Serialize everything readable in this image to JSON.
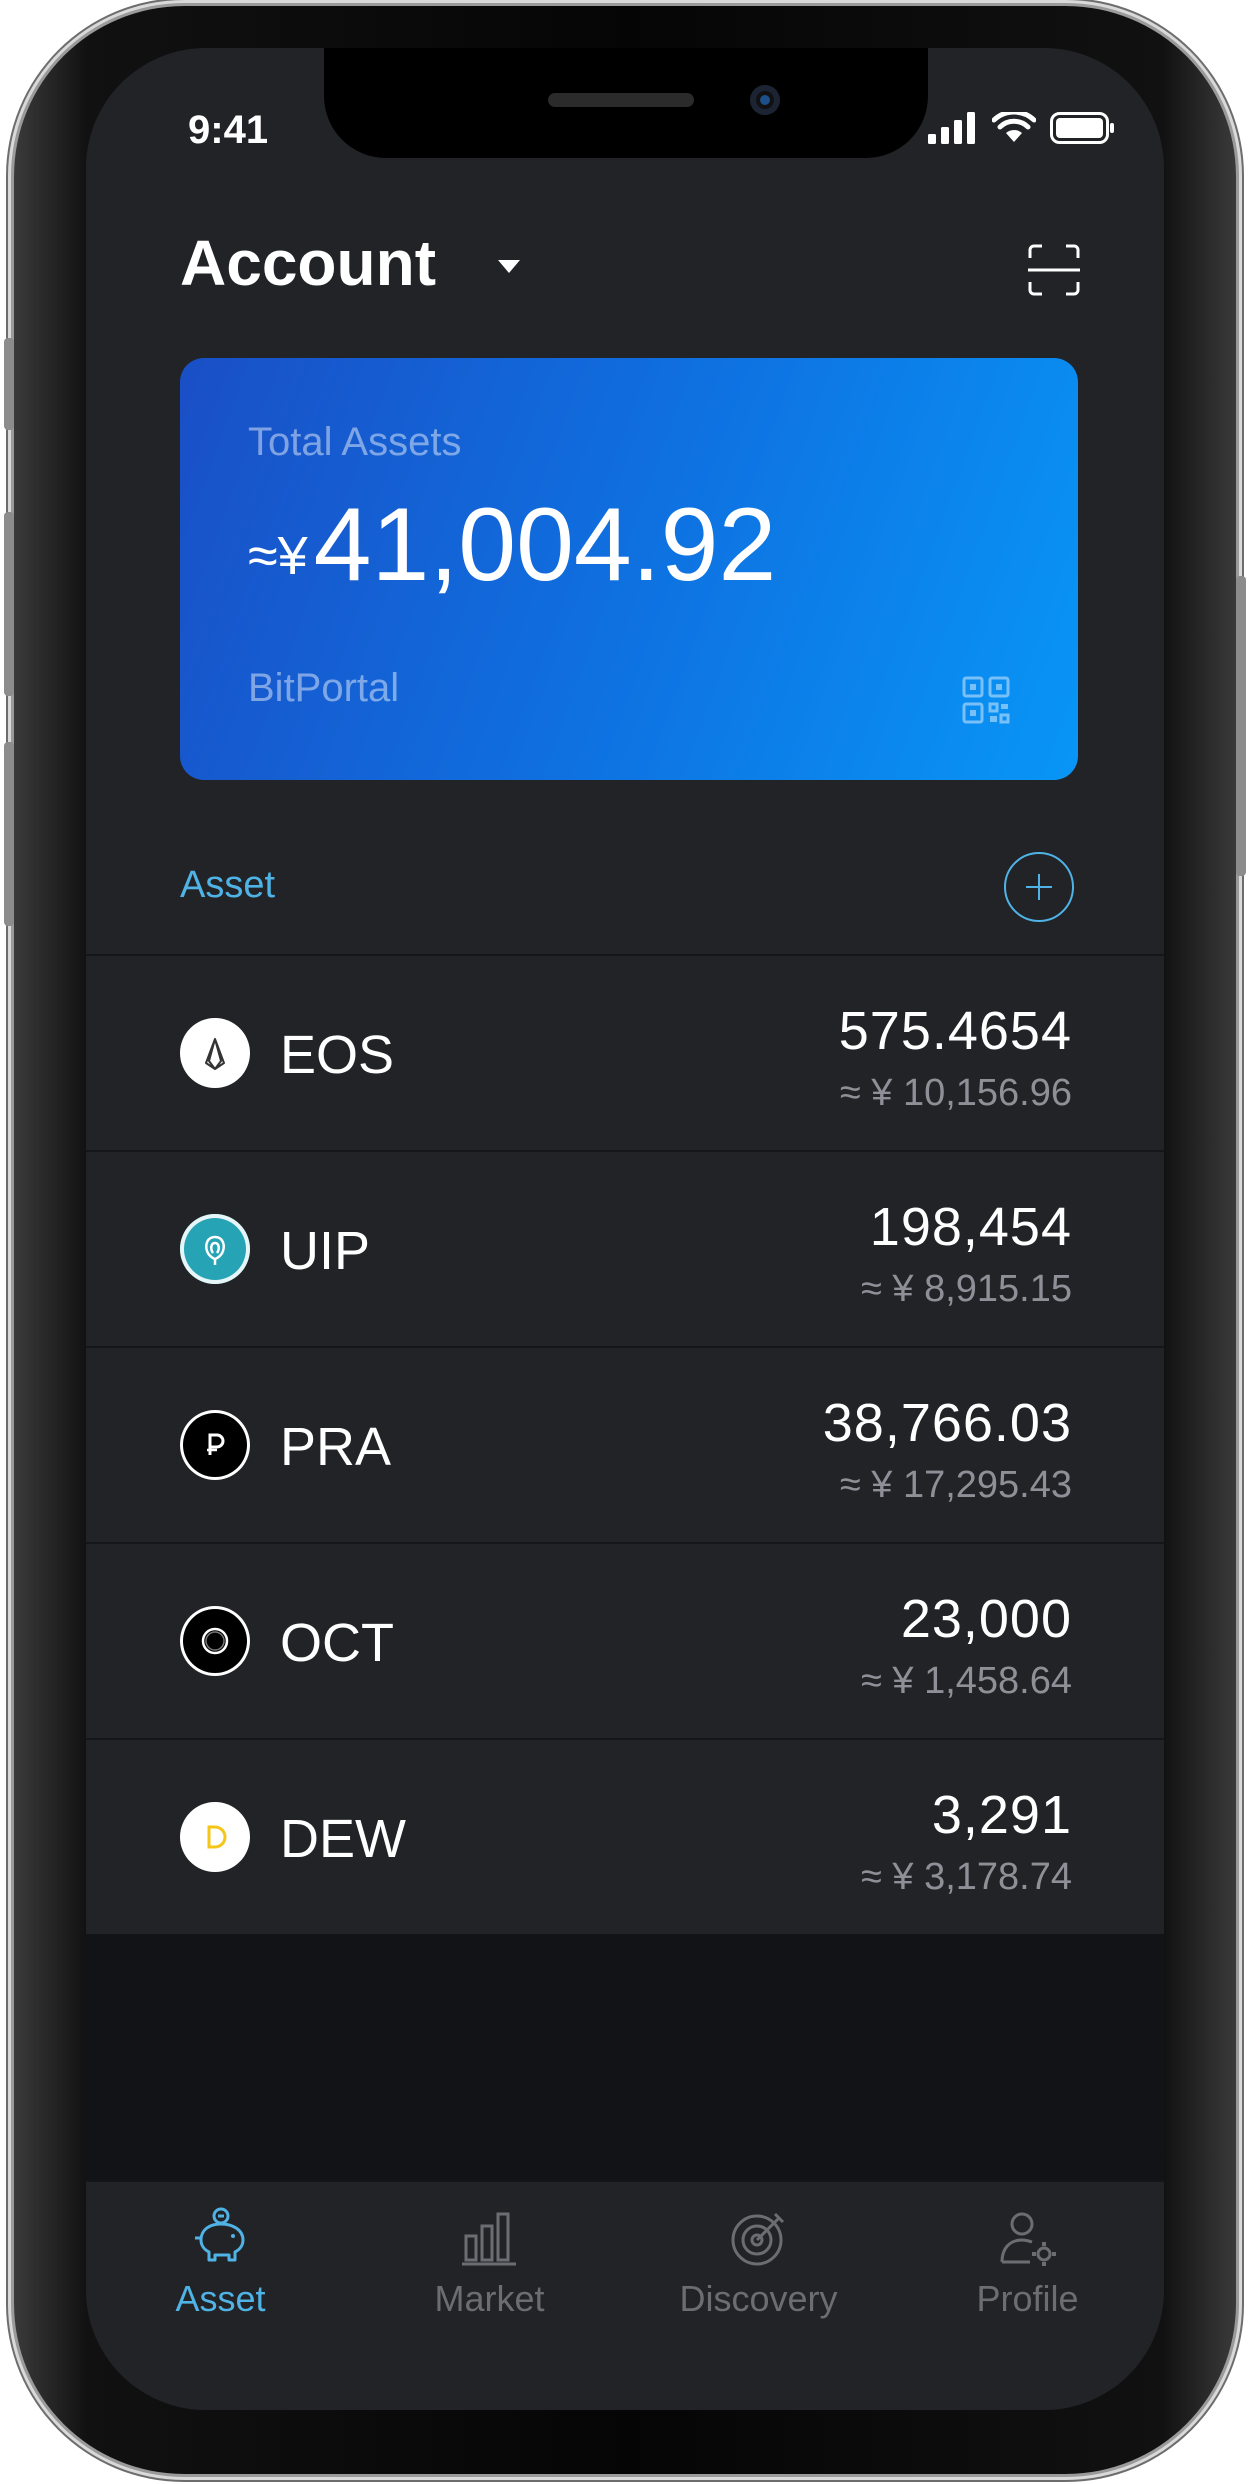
{
  "status_bar": {
    "time": "9:41"
  },
  "header": {
    "title": "Account"
  },
  "total_card": {
    "label": "Total Assets",
    "prefix": "≈¥",
    "value": "41,004.92",
    "brand": "BitPortal"
  },
  "assets_section": {
    "title": "Asset"
  },
  "assets": [
    {
      "symbol": "EOS",
      "amount": "575.4654",
      "value": "≈ ¥ 10,156.96",
      "icon": "eos-icon"
    },
    {
      "symbol": "UIP",
      "amount": "198,454",
      "value": "≈ ¥ 8,915.15",
      "icon": "uip-icon"
    },
    {
      "symbol": "PRA",
      "amount": "38,766.03",
      "value": "≈ ¥ 17,295.43",
      "icon": "pra-icon"
    },
    {
      "symbol": "OCT",
      "amount": "23,000",
      "value": "≈ ¥ 1,458.64",
      "icon": "oct-icon"
    },
    {
      "symbol": "DEW",
      "amount": "3,291",
      "value": "≈ ¥ 3,178.74",
      "icon": "dew-icon"
    }
  ],
  "tabs": [
    {
      "label": "Asset",
      "icon": "piggy-bank-icon",
      "active": true
    },
    {
      "label": "Market",
      "icon": "bar-chart-icon",
      "active": false
    },
    {
      "label": "Discovery",
      "icon": "target-icon",
      "active": false
    },
    {
      "label": "Profile",
      "icon": "user-gear-icon",
      "active": false
    }
  ],
  "colors": {
    "background": "#222327",
    "accent": "#4fb3e6",
    "card_gradient_start": "#1a4fc6",
    "card_gradient_end": "#0896f6",
    "secondary_text": "#8e9097",
    "inactive_tab": "#6b6d73"
  }
}
